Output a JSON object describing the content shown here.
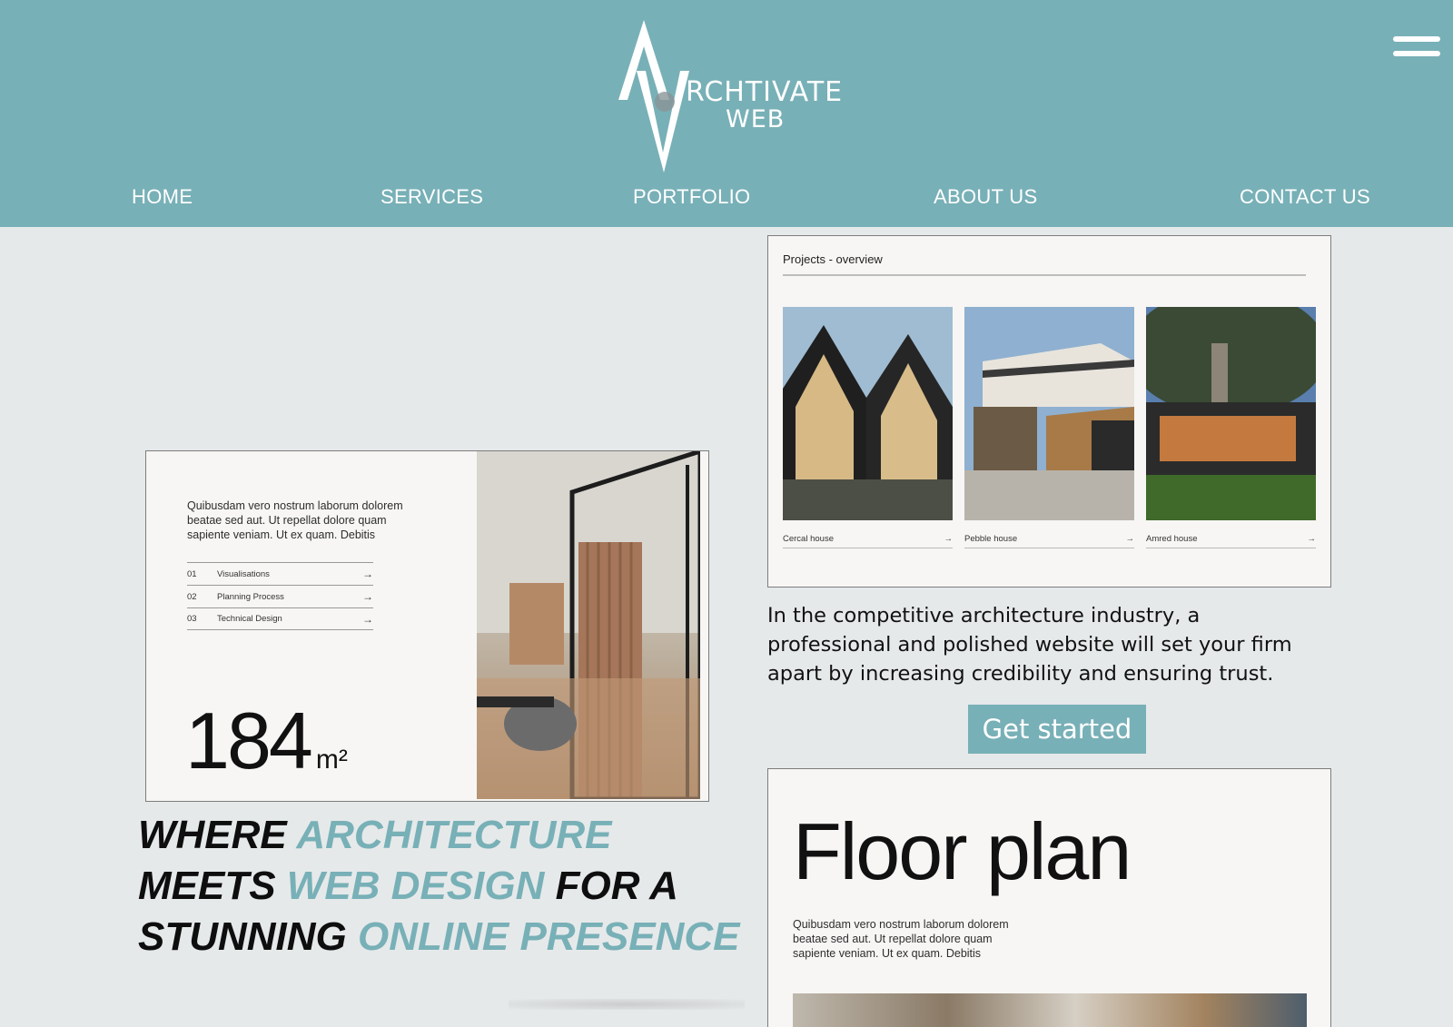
{
  "header": {
    "logo_line1": "RCHTIVATE",
    "logo_line2": "WEB",
    "nav": [
      "HOME",
      "SERVICES",
      "PORTFOLIO",
      "ABOUT US",
      "CONTACT US"
    ]
  },
  "preview_card": {
    "text": "Quibusdam vero nostrum laborum dolorem beatae sed aut. Ut repellat dolore quam sapiente veniam. Ut ex quam. Debitis",
    "items": [
      {
        "num": "01",
        "label": "Visualisations",
        "arrow": "→"
      },
      {
        "num": "02",
        "label": "Planning Process",
        "arrow": "→"
      },
      {
        "num": "03",
        "label": "Technical Design",
        "arrow": "→"
      }
    ],
    "area_value": "184",
    "area_unit": "m²"
  },
  "headline": {
    "line1_a": "WHERE ",
    "line1_b": "ARCHITECTURE",
    "line2_a": "MEETS ",
    "line2_b": "WEB DESIGN",
    "line2_c": " FOR A",
    "line3_a": "STUNNING ",
    "line3_b": "ONLINE PRESENCE"
  },
  "projects": {
    "title": "Projects - overview",
    "houses": [
      {
        "name": "Cercal house",
        "arrow": "→"
      },
      {
        "name": "Pebble house",
        "arrow": "→"
      },
      {
        "name": "Amred house",
        "arrow": "→"
      }
    ]
  },
  "blurb": "In the competitive architecture industry, a professional and polished website will set your firm apart by increasing credibility and ensuring trust.",
  "cta_label": "Get started",
  "floor_plan": {
    "title": "Floor plan",
    "text": "Quibusdam vero nostrum laborum dolorem beatae sed aut. Ut repellat dolore quam sapiente veniam. Ut ex quam. Debitis"
  },
  "colors": {
    "brand": "#78b0b7",
    "page_bg": "#e6e9ea",
    "card_bg": "#f7f6f4"
  },
  "icons": [
    "menu-icon",
    "arrow-right-icon"
  ]
}
